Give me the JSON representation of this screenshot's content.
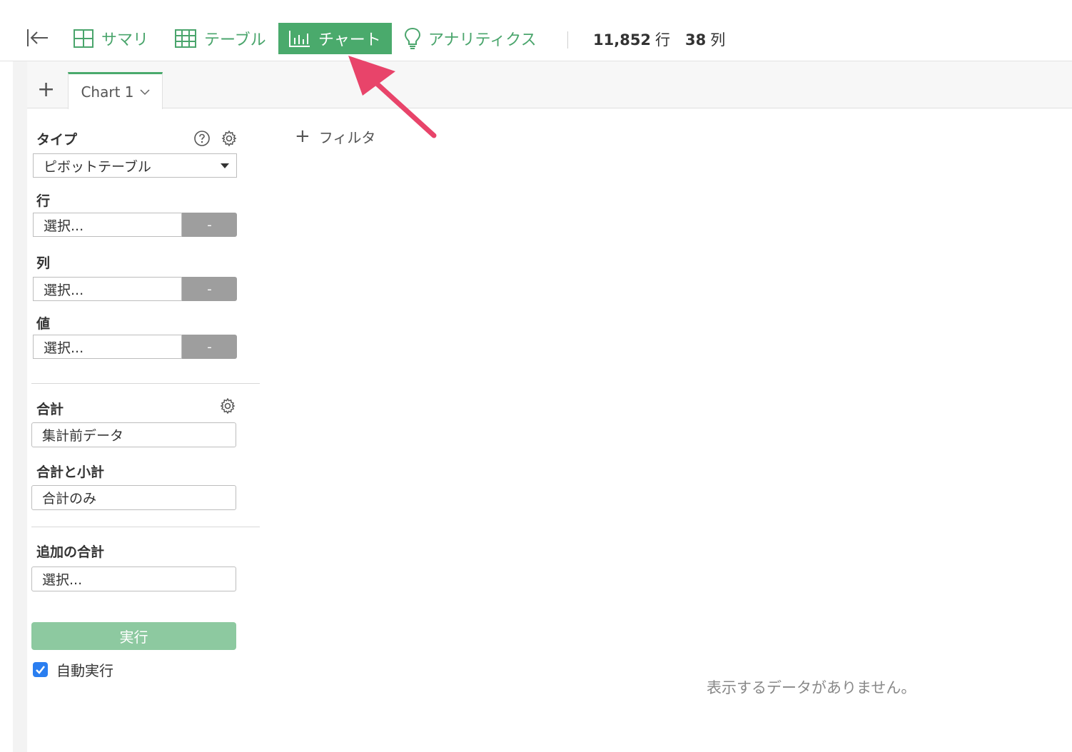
{
  "toolbar": {
    "summary_label": "サマリ",
    "table_label": "テーブル",
    "chart_label": "チャート",
    "analytics_label": "アナリティクス",
    "rows_count": "11,852",
    "rows_unit": "行",
    "cols_count": "38",
    "cols_unit": "列",
    "active_tab": "チャート",
    "accent_color": "#4aaa6c"
  },
  "tabs": {
    "add_label": "+",
    "chart_tab_label": "Chart 1"
  },
  "panel": {
    "type_label": "タイプ",
    "type_value": "ピボットテーブル",
    "row_label": "行",
    "row_placeholder": "選択...",
    "col_label": "列",
    "col_placeholder": "選択...",
    "value_label": "値",
    "value_placeholder": "選択...",
    "dash": "-",
    "total_label": "合計",
    "total_value": "集計前データ",
    "subtotal_label": "合計と小計",
    "subtotal_value": "合計のみ",
    "extra_label": "追加の合計",
    "extra_placeholder": "選択...",
    "run_label": "実行",
    "auto_run_label": "自動実行",
    "auto_run_checked": true
  },
  "main": {
    "filter_label": "フィルタ",
    "empty_message": "表示するデータがありません。"
  }
}
